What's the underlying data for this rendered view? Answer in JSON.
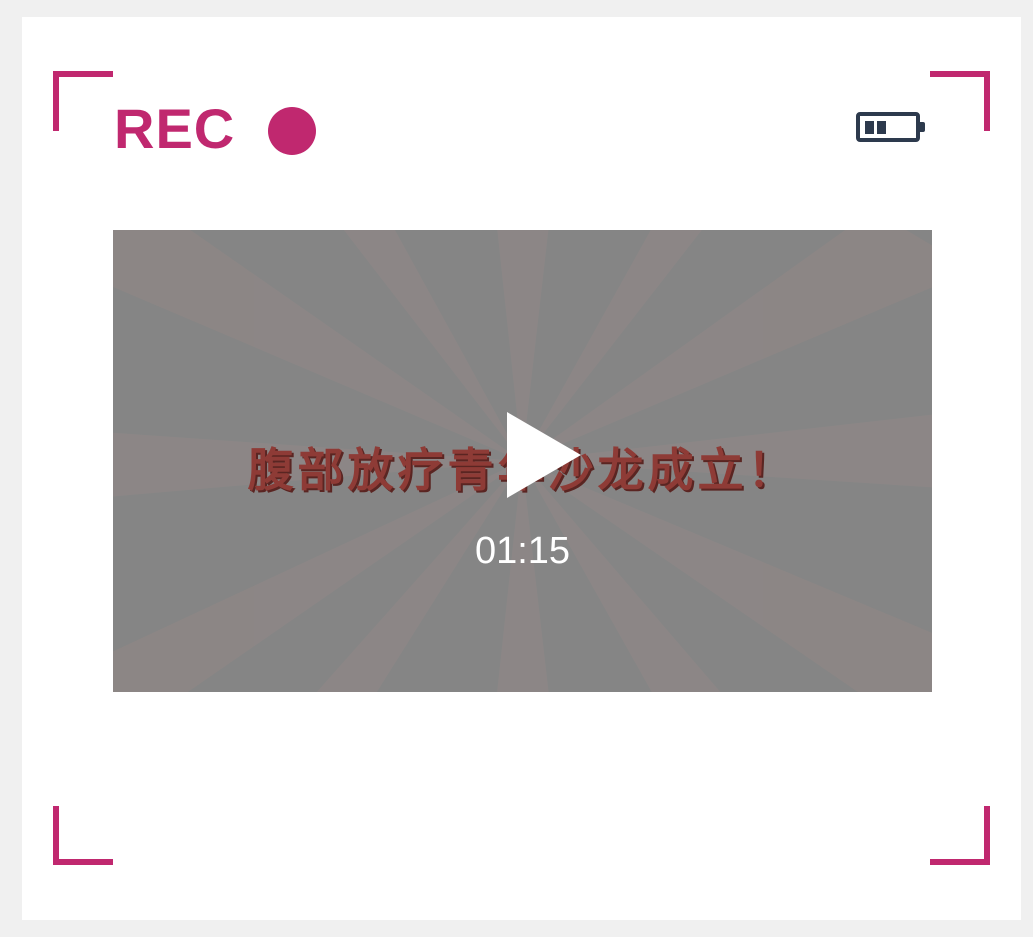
{
  "theme": {
    "accent": "#c0286f",
    "battery_color": "#2d3a4d"
  },
  "recorder": {
    "rec_label": "REC",
    "battery_icon": "battery-icon",
    "battery_level": 0.5
  },
  "video": {
    "caption": "腹部放疗青年沙龙成立！",
    "duration": "01:15",
    "play_icon": "play-icon"
  }
}
